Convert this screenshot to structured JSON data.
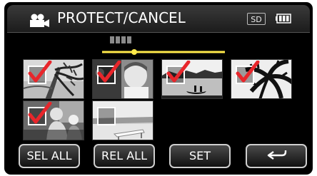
{
  "header": {
    "title": "PROTECT/CANCEL",
    "media_badge": "SD",
    "mode_icon": "video-camera-icon",
    "battery_icon": "battery-icon"
  },
  "pager": {
    "page_indicator_icon": "page-dots-icon",
    "position": 0.25
  },
  "thumbnails": [
    {
      "name": "palm-branch-hammock",
      "checked": true
    },
    {
      "name": "child-portrait",
      "checked": true
    },
    {
      "name": "lake-canoe",
      "checked": true
    },
    {
      "name": "palm-leaves-sky",
      "checked": true
    },
    {
      "name": "family-at-table",
      "checked": true
    },
    {
      "name": "beach-lounge-chair",
      "checked": false
    }
  ],
  "buttons": {
    "select_all": "SEL ALL",
    "release_all": "REL ALL",
    "set": "SET",
    "back_icon": "return-arrow-icon"
  },
  "colors": {
    "check": "#e8262b",
    "slider": "#ffe94a",
    "background": "#000000"
  }
}
